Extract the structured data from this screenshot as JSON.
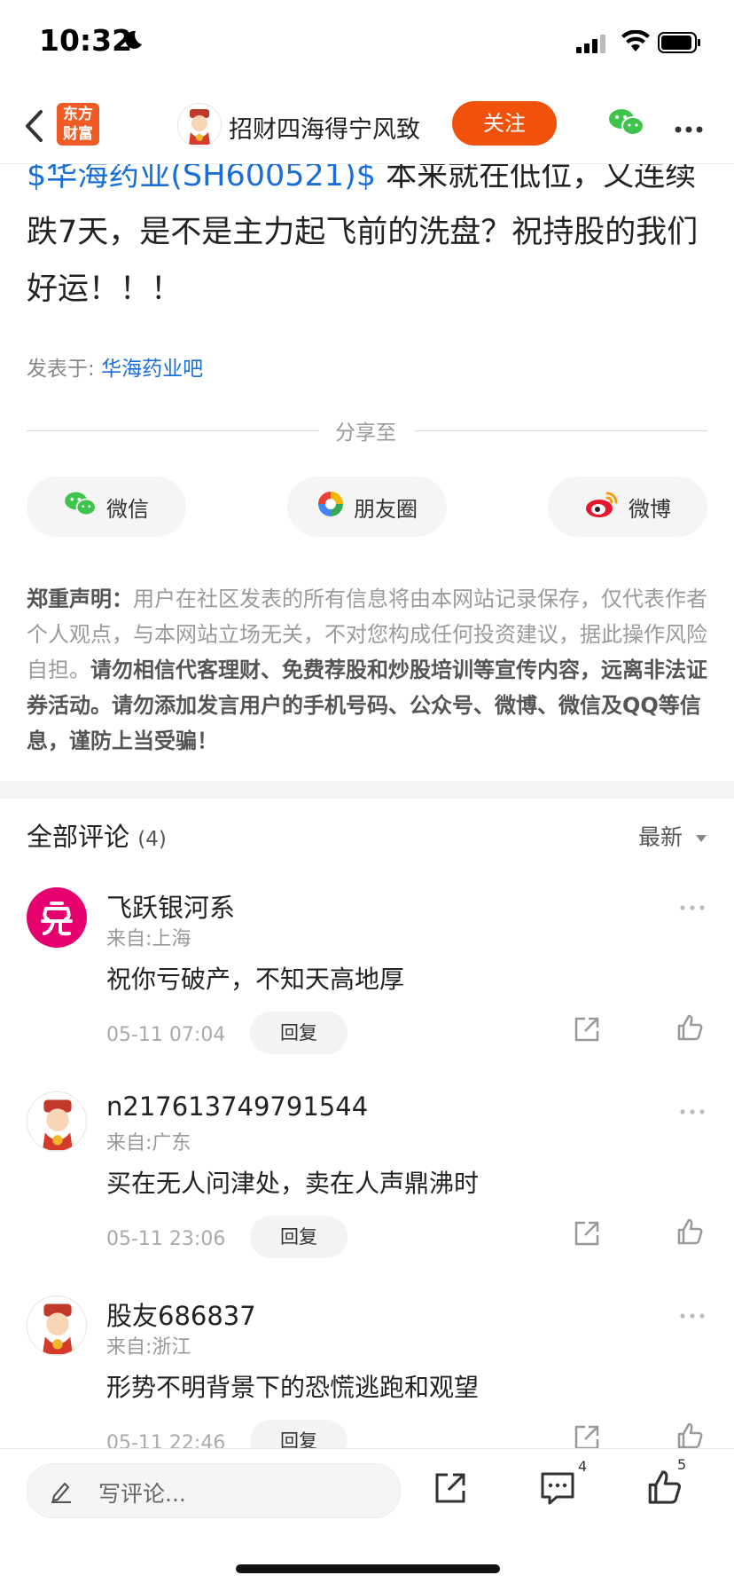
{
  "status_bar": {
    "time": "10:32"
  },
  "header": {
    "logo_line1": "东方",
    "logo_line2": "财富",
    "author": "招财四海得宁风致",
    "follow_label": "关注"
  },
  "article": {
    "stock_link": "$华海药业(SH600521)$",
    "body": " 本来就在低位，又连续跌7天，是不是主力起飞前的洗盘？祝持股的我们好运！！！",
    "posted_prefix": "发表于: ",
    "forum": "华海药业吧"
  },
  "share": {
    "title": "分享至",
    "buttons": [
      {
        "label": "微信",
        "icon": "wechat-icon"
      },
      {
        "label": "朋友圈",
        "icon": "moments-icon"
      },
      {
        "label": "微博",
        "icon": "weibo-icon"
      }
    ]
  },
  "disclaimer": {
    "head": "郑重声明：",
    "normal": "用户在社区发表的所有信息将由本网站记录保存，仅代表作者个人观点，与本网站立场无关，不对您构成任何投资建议，据此操作风险自担。",
    "bold": "请勿相信代客理财、免费荐股和炒股培训等宣传内容，远离非法证券活动。请勿添加发言用户的手机号码、公众号、微博、微信及QQ等信息，谨防上当受骗！"
  },
  "comments_section": {
    "title": "全部评论",
    "count": "(4)",
    "sort_label": "最新",
    "reply_label": "回复",
    "items": [
      {
        "name": "飞跃银河系",
        "location": "来自:上海",
        "text": "祝你亏破产，不知天高地厚",
        "time": "05-11 07:04"
      },
      {
        "name": "n217613749791544",
        "location": "来自:广东",
        "text": "买在无人问津处，卖在人声鼎沸时",
        "time": "05-11 23:06"
      },
      {
        "name": "股友686837",
        "location": "来自:浙江",
        "text": "形势不明背景下的恐慌逃跑和观望",
        "time": "05-11 22:46"
      }
    ]
  },
  "bottom_bar": {
    "placeholder": "写评论...",
    "comment_count": "4",
    "like_count": "5"
  },
  "colors": {
    "accent": "#f0520b",
    "link": "#1a6fd6"
  }
}
